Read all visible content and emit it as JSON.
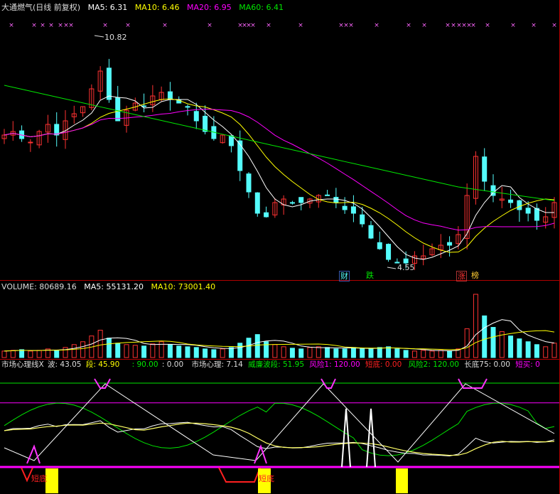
{
  "colors": {
    "up": "#ff3232",
    "down": "#54fcfc",
    "ma5": "#ffffff",
    "ma10": "#ffff00",
    "ma20": "#ff00ff",
    "ma60": "#00e600",
    "bg": "#000000",
    "grid": "#b00000"
  },
  "main_header": {
    "name": "大通燃气(日线 前复权)",
    "ma5": "MA5: 6.31",
    "ma10": "MA10: 6.46",
    "ma20": "MA20: 6.95",
    "ma60": "MA60: 6.41"
  },
  "markers": {
    "high_label": "10.82",
    "low_label": "4.55",
    "tag_finance": "财",
    "tag_fall": "跌",
    "tag_rise": "涨",
    "tag_rank": "榜"
  },
  "vol_header": {
    "volume": "VOLUME: 80689.16",
    "ma5": "MA5: 55131.20",
    "ma10": "MA10: 73001.40"
  },
  "ind_header": {
    "name": "市场心理线X",
    "wave": "波: 43.05",
    "seg": "段: 45.90",
    "v90": ": 90.00",
    "v0": ": 0.00",
    "psy": "市场心理: 7.14",
    "wpsy": "威廉波段: 51.95",
    "risk1": "风险1: 120.00",
    "short1": "短底: 0.00",
    "risk2": "风险2: 120.00",
    "long75": "长底75: 0.00",
    "shortbuy": "短买: 0"
  },
  "indicator_labels": {
    "short_bottom": "短底"
  },
  "chart_data": [
    {
      "type": "candlestick",
      "title": "大通燃气(日线 前复权)",
      "ylim": [
        4.2,
        11.6
      ],
      "annotations": [
        {
          "label": "10.82",
          "kind": "high"
        },
        {
          "label": "4.55",
          "kind": "low"
        }
      ],
      "series": [
        {
          "name": "MA5",
          "last": 6.31
        },
        {
          "name": "MA10",
          "last": 6.46
        },
        {
          "name": "MA20",
          "last": 6.95
        },
        {
          "name": "MA60",
          "last": 6.41
        }
      ],
      "close_path": [
        8.2,
        8.3,
        8.1,
        8.0,
        8.3,
        8.5,
        8.2,
        8.6,
        8.8,
        9.0,
        9.5,
        10.0,
        9.2,
        8.6,
        8.9,
        9.1,
        9.0,
        9.3,
        9.4,
        9.2,
        9.1,
        9.0,
        8.6,
        8.3,
        8.1,
        8.2,
        7.9,
        7.2,
        6.6,
        6.0,
        5.9,
        6.3,
        6.4,
        6.3,
        6.3,
        6.4,
        6.5,
        6.5,
        6.3,
        6.1,
        6.0,
        5.7,
        5.3,
        5.0,
        4.7,
        4.6,
        4.6,
        4.8,
        4.8,
        5.0,
        5.1,
        5.1,
        5.4,
        6.5,
        7.6,
        6.9,
        6.5,
        6.4,
        6.3,
        6.1,
        6.0,
        5.8,
        5.9,
        6.3
      ]
    },
    {
      "type": "bar",
      "title": "VOLUME",
      "series": [
        {
          "name": "VOLUME",
          "last": 80689.16
        },
        {
          "name": "MA5",
          "last": 55131.2
        },
        {
          "name": "MA10",
          "last": 73001.4
        }
      ],
      "values": [
        9,
        10,
        11,
        9,
        10,
        12,
        10,
        14,
        18,
        22,
        30,
        38,
        27,
        20,
        18,
        17,
        16,
        19,
        22,
        18,
        16,
        15,
        14,
        12,
        11,
        12,
        14,
        20,
        27,
        32,
        22,
        18,
        15,
        13,
        12,
        14,
        15,
        14,
        12,
        12,
        14,
        13,
        12,
        14,
        15,
        12,
        10,
        9,
        10,
        9,
        10,
        9,
        12,
        40,
        88,
        58,
        42,
        36,
        30,
        26,
        22,
        18,
        15,
        20
      ]
    },
    {
      "type": "line",
      "title": "市场心理线X",
      "ylim": [
        0,
        120
      ],
      "series": [
        {
          "name": "威廉波段",
          "last": 51.95
        },
        {
          "name": "市场心理",
          "last": 7.14
        },
        {
          "name": "风险1",
          "last": 120.0
        },
        {
          "name": "风险2",
          "last": 120.0
        }
      ]
    }
  ]
}
